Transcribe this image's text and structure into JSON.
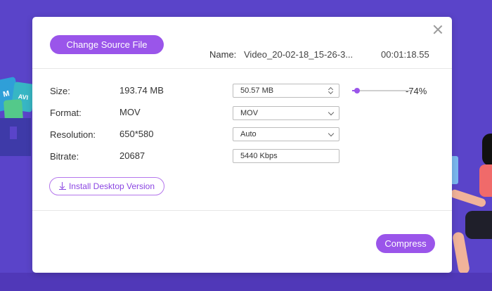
{
  "background": {
    "file_badge_a": "M",
    "file_badge_b": "AVI"
  },
  "dialog": {
    "change_source_label": "Change Source File",
    "name_label": "Name:",
    "name_value": "Video_20-02-18_15-26-3...",
    "duration": "00:01:18.55",
    "rows": [
      {
        "label": "Size:",
        "value": "193.74 MB"
      },
      {
        "label": "Format:",
        "value": "MOV"
      },
      {
        "label": "Resolution:",
        "value": "650*580"
      },
      {
        "label": "Bitrate:",
        "value": "20687"
      }
    ],
    "size_input": "50.57  MB",
    "format_select": "MOV",
    "resolution_select": "Auto",
    "bitrate_input": "5440 Kbps",
    "slider_fraction": 0.08,
    "percent_label": "-74%",
    "install_label": "Install Desktop Version",
    "compress_label": "Compress"
  },
  "colors": {
    "accent": "#9a55ea",
    "background": "#5a44c9"
  },
  "icons": {
    "close": "close-icon",
    "download": "download-icon",
    "chevron": "chevron-down-icon",
    "stepper": "up-down-stepper-icon"
  }
}
